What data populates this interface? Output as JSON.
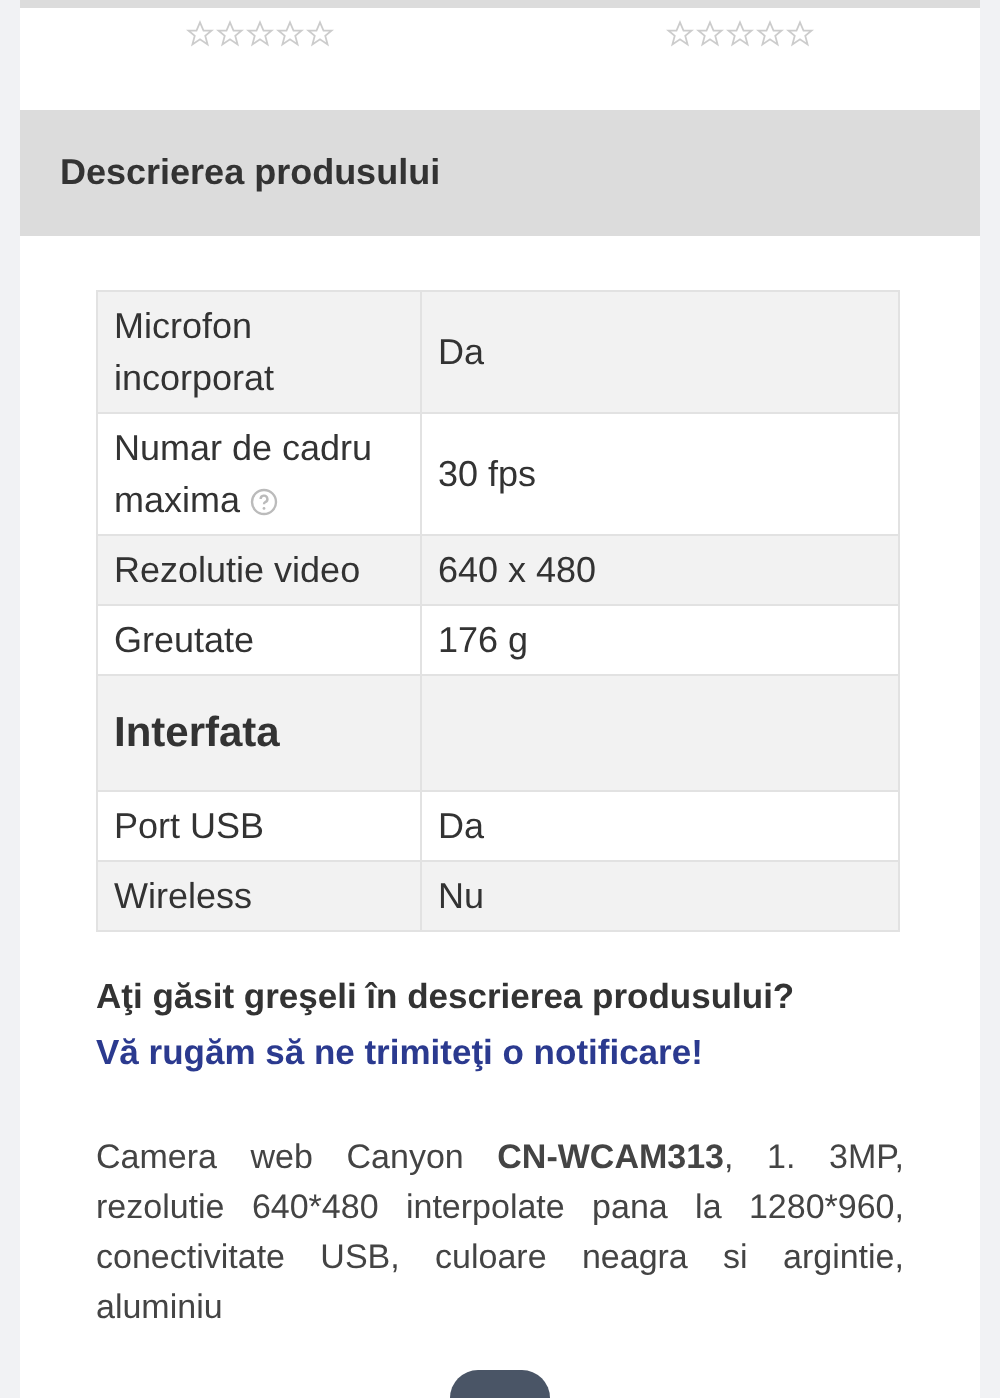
{
  "ratings": [
    {
      "stars": 0
    },
    {
      "stars": 0
    }
  ],
  "section_title": "Descrierea produsului",
  "specs": [
    {
      "kind": "spec",
      "label": "Microfon incorporat",
      "value": "Da"
    },
    {
      "kind": "spec",
      "label": "Numar de cadru maxima",
      "value": "30 fps",
      "help": true
    },
    {
      "kind": "spec",
      "label": "Rezolutie video",
      "value": "640 x 480"
    },
    {
      "kind": "spec",
      "label": "Greutate",
      "value": "176 g"
    },
    {
      "kind": "section",
      "label": "Interfata"
    },
    {
      "kind": "spec",
      "label": "Port USB",
      "value": "Da"
    },
    {
      "kind": "spec",
      "label": "Wireless",
      "value": "Nu"
    }
  ],
  "report": {
    "question": "Aţi găsit greşeli în descrierea produsului?",
    "link": "Vă rugăm să ne trimiteţi o notificare!"
  },
  "description": "Camera web Canyon **CN-WCAM313**, 1. 3MP, rezolutie 640*480 interpolate pana la 1280*960, conectivitate USB, culoare neagra si argintie, aluminiu"
}
